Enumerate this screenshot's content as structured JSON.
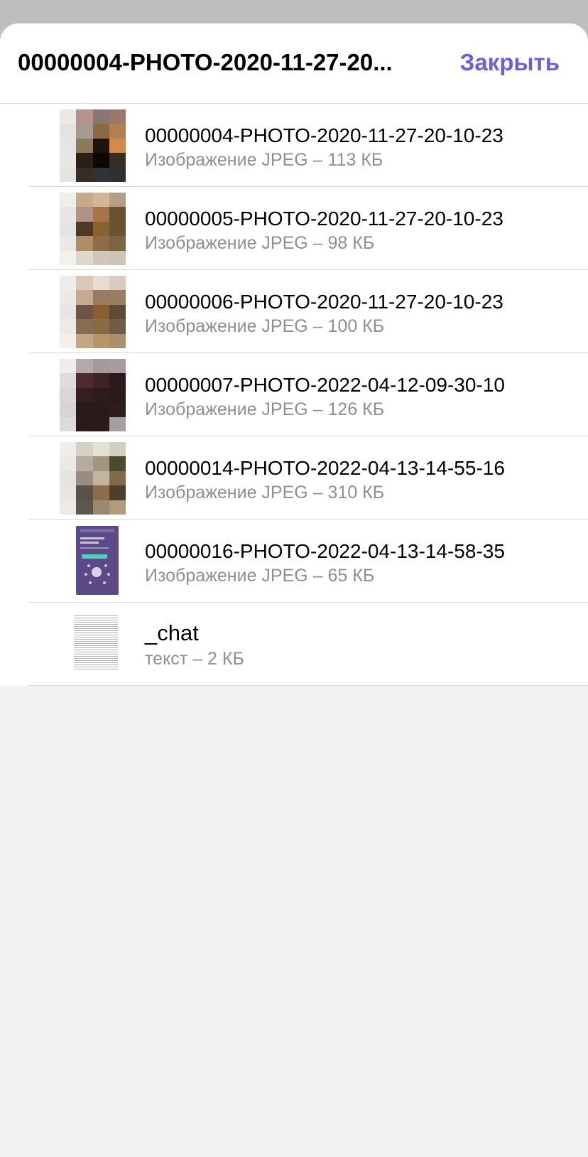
{
  "header": {
    "title": "00000004-PHOTO-2020-11-27-20...",
    "close_label": "Закрыть"
  },
  "files": [
    {
      "name": "00000004-PHOTO-2020-11-27-20-10-23",
      "meta": "Изображение JPEG – 113 КБ"
    },
    {
      "name": "00000005-PHOTO-2020-11-27-20-10-23",
      "meta": "Изображение JPEG – 98 КБ"
    },
    {
      "name": "00000006-PHOTO-2020-11-27-20-10-23",
      "meta": "Изображение JPEG – 100 КБ"
    },
    {
      "name": "00000007-PHOTO-2022-04-12-09-30-10",
      "meta": "Изображение JPEG – 126 КБ"
    },
    {
      "name": "00000014-PHOTO-2022-04-13-14-55-16",
      "meta": "Изображение JPEG – 310 КБ"
    },
    {
      "name": "00000016-PHOTO-2022-04-13-14-58-35",
      "meta": "Изображение JPEG – 65 КБ"
    },
    {
      "name": "_chat",
      "meta": "текст – 2 КБ"
    }
  ],
  "colors": {
    "accent": "#6e5fd6",
    "secondary_text": "#8e8e93"
  }
}
